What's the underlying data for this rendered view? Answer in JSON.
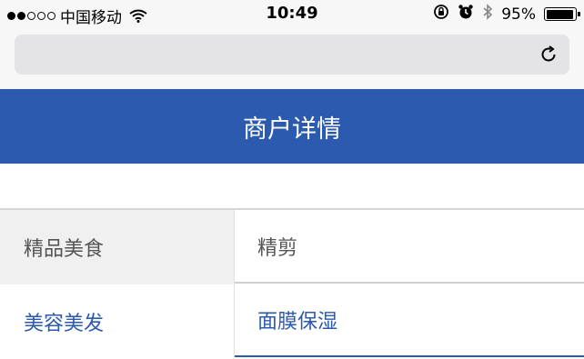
{
  "status_bar": {
    "carrier": "中国移动",
    "time": "10:49",
    "battery_percent": "95%",
    "battery_level": 0.95,
    "signal_strength": 2,
    "icons": [
      "wifi-icon",
      "rotation-lock-icon",
      "alarm-icon",
      "bluetooth-icon",
      "battery-icon"
    ]
  },
  "browser": {
    "url": "",
    "reload_icon": "reload-icon"
  },
  "header": {
    "title": "商户详情"
  },
  "category_menu": [
    {
      "label": "精品美食",
      "selected": true
    },
    {
      "label": "美容美发",
      "selected": false
    }
  ],
  "subcategory_list": [
    {
      "label": "精剪"
    },
    {
      "label": "面膜保湿"
    }
  ],
  "colors": {
    "header_bg": "#2b5aae",
    "accent": "#2b5aae",
    "selected_bg": "#f0f0f0"
  }
}
